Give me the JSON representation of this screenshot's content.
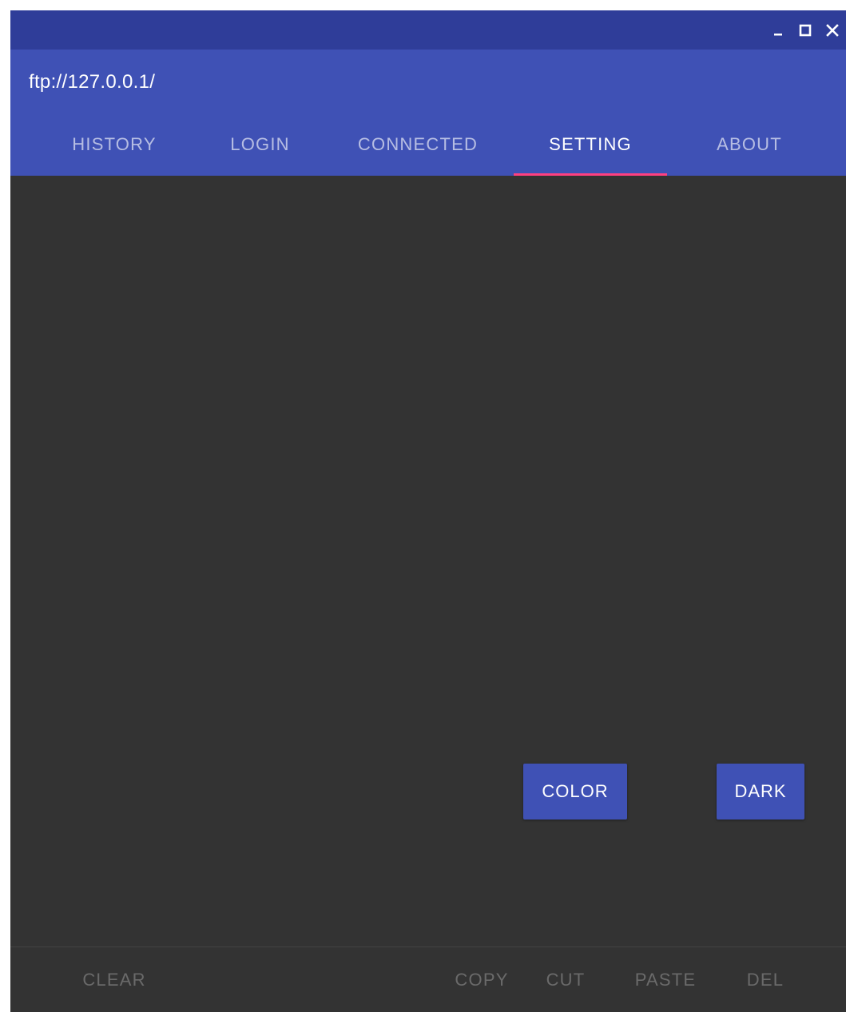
{
  "window": {
    "controls": {
      "minimize_icon": "minimize-icon",
      "maximize_icon": "maximize-icon",
      "close_icon": "close-icon"
    }
  },
  "header": {
    "address": "ftp://127.0.0.1/"
  },
  "tabs": [
    {
      "label": "HISTORY",
      "active": false
    },
    {
      "label": "LOGIN",
      "active": false
    },
    {
      "label": "CONNECTED",
      "active": false
    },
    {
      "label": "SETTING",
      "active": true
    },
    {
      "label": "ABOUT",
      "active": false
    }
  ],
  "settings": {
    "color_button": "COLOR",
    "dark_button": "DARK"
  },
  "bottom_bar": {
    "clear": "CLEAR",
    "copy": "COPY",
    "cut": "CUT",
    "paste": "PASTE",
    "del": "DEL"
  },
  "colors": {
    "titlebar": "#2f3d99",
    "primary": "#3f51b5",
    "accent": "#ff4081",
    "background": "#333333",
    "disabled_text": "#6a6a6a"
  }
}
